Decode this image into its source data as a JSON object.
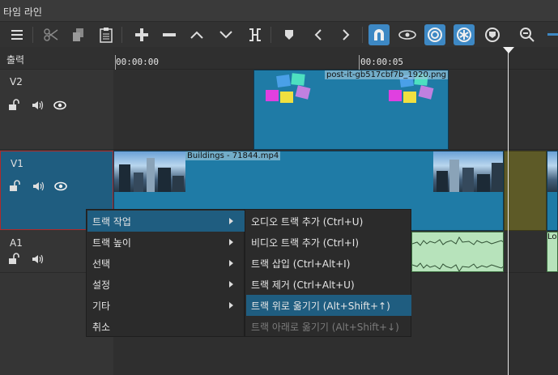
{
  "window": {
    "title": "타임 라인"
  },
  "toolbar": {
    "buttons": [
      {
        "name": "menu-icon"
      },
      {
        "name": "cut-icon"
      },
      {
        "name": "copy-icon"
      },
      {
        "name": "paste-icon"
      },
      {
        "name": "add-icon"
      },
      {
        "name": "remove-icon"
      },
      {
        "name": "lift-icon"
      },
      {
        "name": "overwrite-icon"
      },
      {
        "name": "split-icon"
      },
      {
        "name": "marker-icon"
      },
      {
        "name": "prev-marker-icon"
      },
      {
        "name": "next-marker-icon"
      },
      {
        "name": "snap-icon",
        "active": true
      },
      {
        "name": "scrub-icon"
      },
      {
        "name": "ripple-icon",
        "active": true
      },
      {
        "name": "ripple-all-icon",
        "active": true
      },
      {
        "name": "ripple-markers-icon"
      },
      {
        "name": "zoom-out-icon"
      }
    ],
    "accent": "#3d88c4"
  },
  "headers": {
    "output_label": "출력",
    "tracks": [
      {
        "id": "v2",
        "name": "V2",
        "icons": [
          "unlock-icon",
          "volume-icon",
          "eye-icon"
        ]
      },
      {
        "id": "v1",
        "name": "V1",
        "icons": [
          "unlock-icon",
          "volume-icon",
          "eye-icon"
        ],
        "selected": true
      },
      {
        "id": "a1",
        "name": "A1",
        "icons": [
          "unlock-icon",
          "volume-icon"
        ]
      }
    ]
  },
  "ruler": {
    "timecodes": [
      "00:00:00",
      "00:00:05"
    ]
  },
  "clips": {
    "v2_clip": {
      "name": "post-it-gb517cbf7b_1920.png"
    },
    "v1_clip": {
      "name": "Buildings - 71844.mp4"
    },
    "a1_clip": {
      "name": "Lo"
    }
  },
  "context_menu": {
    "items": [
      {
        "label": "트랙 작업",
        "submenu": true,
        "highlighted": true
      },
      {
        "label": "트랙 높이",
        "submenu": true
      },
      {
        "label": "선택",
        "submenu": true
      },
      {
        "label": "설정",
        "submenu": true
      },
      {
        "label": "기타",
        "submenu": true
      },
      {
        "label": "취소",
        "submenu": false
      }
    ],
    "submenu_items": [
      {
        "label": "오디오 트랙 추가 (Ctrl+U)"
      },
      {
        "label": "비디오 트랙 추가 (Ctrl+I)"
      },
      {
        "label": "트랙 삽입 (Ctrl+Alt+I)"
      },
      {
        "label": "트랙 제거 (Ctrl+Alt+U)"
      },
      {
        "label": "트랙 위로 옮기기 (Alt+Shift+↑)",
        "highlighted": true
      },
      {
        "label": "트랙 아래로 옮기기 (Alt+Shift+↓)",
        "disabled": true
      }
    ]
  }
}
